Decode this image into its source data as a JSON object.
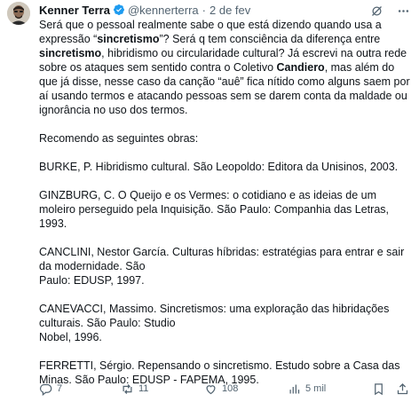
{
  "author": {
    "name": "Kenner Terra",
    "handle": "@kennerterra",
    "separator": "·",
    "date": "2 de fev"
  },
  "content": {
    "p1_a": "Será que o pessoal realmente sabe o que está dizendo quando usa a expressão “",
    "p1_b": "sincretismo",
    "p1_c": "”? Será q tem consciência da diferença entre ",
    "p1_d": "sincretismo",
    "p1_e": ", hibridismo ou circularidade cultural? Já escrevi na outra rede sobre os ataques sem sentido contra o Coletivo ",
    "p1_f": "Candiero",
    "p1_g": ", mas além do que já disse, nesse caso da canção “auê” fica nítido como alguns saem por aí usando termos e atacando pessoas sem se darem conta da maldade ou ignorância no uso dos termos.",
    "p2": "Recomendo as seguintes obras:",
    "ref1": "BURKE, P. Hibridismo cultural. São Leopoldo: Editora da Unisinos, 2003.",
    "ref2": "GINZBURG, C. O Queijo e os Vermes: o cotidiano e as ideias de um moleiro perseguido pela Inquisição. São Paulo: Companhia das Letras, 1993.",
    "ref3_a": "CANCLINI, Nestor García. Culturas híbridas: estratégias para entrar e sair da modernidade. São",
    "ref3_b": "Paulo: EDUSP, 1997.",
    "ref4_a": "CANEVACCI, Massimo. Sincretismos: uma exploração das hibridações culturais. São Paulo: Studio",
    "ref4_b": "Nobel, 1996.",
    "ref5": "FERRETTI, Sérgio. Repensando o sincretismo. Estudo sobre a Casa das Minas. São Paulo: EDUSP - FAPEMA, 1995."
  },
  "actions": {
    "replies": "7",
    "reposts": "11",
    "likes": "108",
    "views": "5 mil"
  },
  "colors": {
    "verified": "#1d9bf0",
    "text": "#0f1419",
    "muted": "#536471"
  },
  "icons": [
    "grok-icon",
    "more-icon",
    "reply-icon",
    "repost-icon",
    "like-icon",
    "views-icon",
    "bookmark-icon",
    "share-icon"
  ]
}
